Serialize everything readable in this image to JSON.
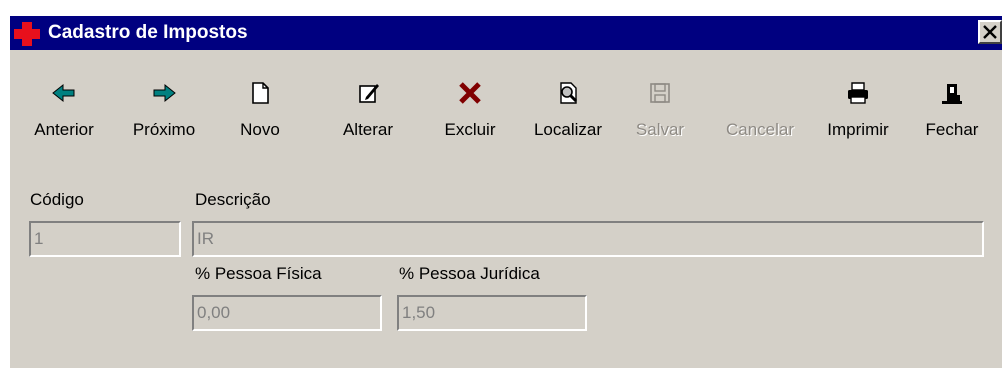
{
  "window": {
    "title": "Cadastro de Impostos"
  },
  "toolbar": {
    "anterior": "Anterior",
    "proximo": "Próximo",
    "novo": "Novo",
    "alterar": "Alterar",
    "excluir": "Excluir",
    "localizar": "Localizar",
    "salvar": "Salvar",
    "cancelar": "Cancelar",
    "imprimir": "Imprimir",
    "fechar": "Fechar"
  },
  "form": {
    "codigo_label": "Código",
    "codigo_value": "1",
    "descricao_label": "Descrição",
    "descricao_value": "IR",
    "pessoa_fisica_label": "% Pessoa Física",
    "pessoa_fisica_value": "0,00",
    "pessoa_juridica_label": "% Pessoa Jurídica",
    "pessoa_juridica_value": "1,50"
  },
  "colors": {
    "titlebar": "#000080",
    "face": "#d4d0c8",
    "arrow": "#008080",
    "delete": "#800000",
    "disabled_text": "#8e8a84"
  },
  "icons": {
    "anterior": "arrow-left-icon",
    "proximo": "arrow-right-icon",
    "novo": "new-document-icon",
    "alterar": "edit-document-icon",
    "excluir": "delete-x-icon",
    "localizar": "find-document-icon",
    "salvar": "floppy-disk-icon",
    "cancelar": "cancel-icon",
    "imprimir": "printer-icon",
    "fechar": "close-door-icon",
    "app": "red-cross-icon",
    "close": "close-icon"
  }
}
